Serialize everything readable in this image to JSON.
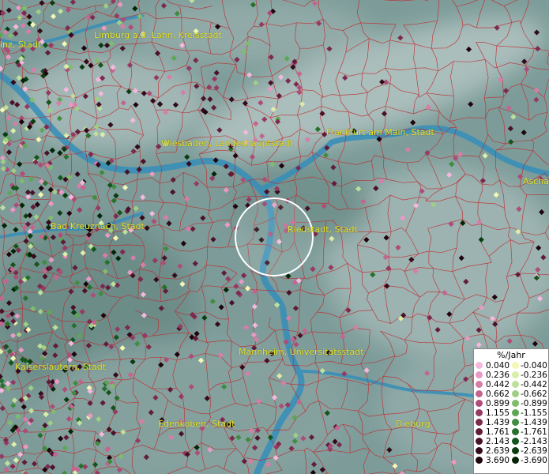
{
  "cities": [
    {
      "name": "inz, Stadt",
      "key": "mainz"
    },
    {
      "name": "Limburg a.d. Lahn, Kreisstadt",
      "key": "limburg"
    },
    {
      "name": "Wiesbaden, Landeshauptstadt",
      "key": "wiesbaden"
    },
    {
      "name": "Frankfurt am Main, Stadt",
      "key": "frankfurt"
    },
    {
      "name": "Ascha",
      "key": "aschaffenburg"
    },
    {
      "name": "Bad Kreuznach, Stadt",
      "key": "bad-kreuznach"
    },
    {
      "name": "Riedstadt, Stadt",
      "key": "riedstadt"
    },
    {
      "name": "Kaiserslautern, Stadt",
      "key": "kaiserslautern"
    },
    {
      "name": "Mannheim, Universitätsstadt",
      "key": "mannheim"
    },
    {
      "name": "Edenkoben, Stadt",
      "key": "edenkoben"
    },
    {
      "name": "Dieburg",
      "key": "dieburg"
    }
  ],
  "legend": {
    "title": "%/Jahr",
    "positive": [
      {
        "label": "0.040",
        "color": "#f3b8dc"
      },
      {
        "label": "0.236",
        "color": "#e89ac4"
      },
      {
        "label": "0.442",
        "color": "#d77da8"
      },
      {
        "label": "0.662",
        "color": "#c46590"
      },
      {
        "label": "0.899",
        "color": "#ad4d78"
      },
      {
        "label": "1.155",
        "color": "#953a62"
      },
      {
        "label": "1.439",
        "color": "#7c2a4d"
      },
      {
        "label": "1.761",
        "color": "#621c39"
      },
      {
        "label": "2.143",
        "color": "#4a1228"
      },
      {
        "label": "2.639",
        "color": "#330a1a"
      },
      {
        "label": "3.690",
        "color": "#1e040c"
      }
    ],
    "negative": [
      {
        "label": "-0.040",
        "color": "#f4f7b4"
      },
      {
        "label": "-0.236",
        "color": "#dcedaa"
      },
      {
        "label": "-0.442",
        "color": "#bfe09a"
      },
      {
        "label": "-0.662",
        "color": "#9fcf84"
      },
      {
        "label": "-0.899",
        "color": "#7fbc6c"
      },
      {
        "label": "-1.155",
        "color": "#5ea654"
      },
      {
        "label": "-1.439",
        "color": "#408c40"
      },
      {
        "label": "-1.761",
        "color": "#27702c"
      },
      {
        "label": "-2.143",
        "color": "#15551c"
      },
      {
        "label": "-2.639",
        "color": "#0a3c10"
      },
      {
        "label": "-3.690",
        "color": "#032406"
      }
    ]
  },
  "colors": {
    "terrain": "#7b9b98",
    "river": "#3a8fb8",
    "boundary": "#c0282d",
    "label": "#e6e62a"
  }
}
